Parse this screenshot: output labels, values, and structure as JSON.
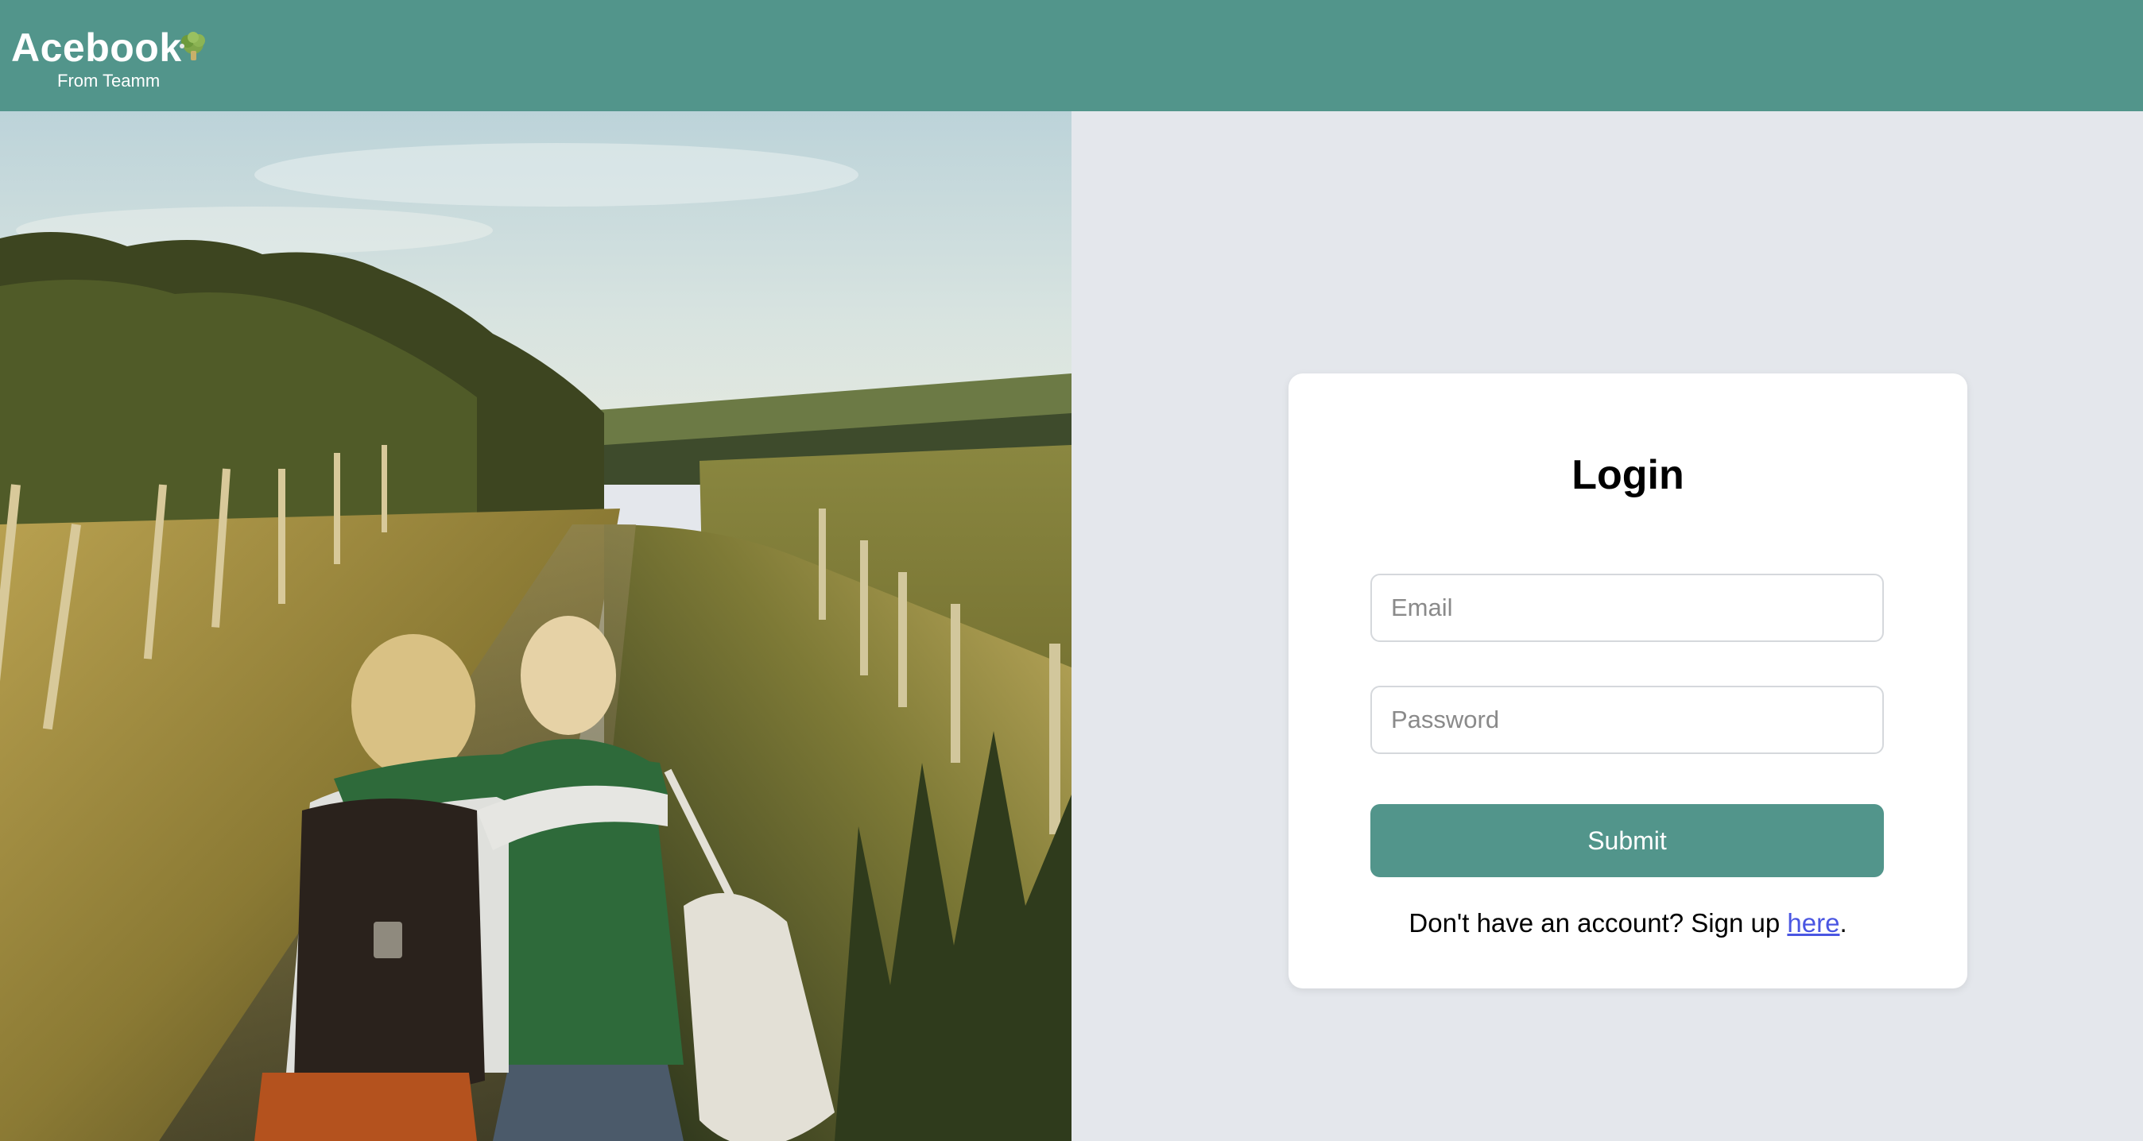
{
  "header": {
    "brand_name": "Acebook",
    "tagline": "From Teamm",
    "logo_icon": "broccoli-icon",
    "background_color": "#52958b"
  },
  "hero": {
    "image_icon": "photo-two-friends-walking-field"
  },
  "login": {
    "title": "Login",
    "email_placeholder": "Email",
    "email_value": "",
    "password_placeholder": "Password",
    "password_value": "",
    "submit_label": "Submit",
    "signup_prefix": "Don't have an account? Sign up ",
    "signup_link": "here",
    "signup_suffix": ".",
    "accent_color": "#52958b",
    "link_color": "#4a56e2"
  }
}
